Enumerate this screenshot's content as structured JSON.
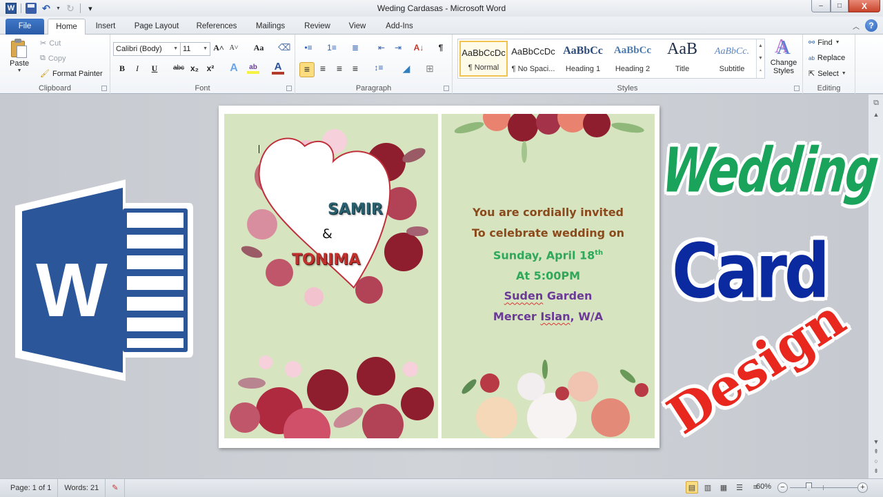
{
  "window": {
    "title": "Weding Cardasas - Microsoft Word",
    "controls": {
      "minimize": "–",
      "maximize": "□",
      "close": "X"
    }
  },
  "quick_access": {
    "app_icon_letter": "W",
    "undo_glyph": "↶",
    "redo_glyph": "↻",
    "customize_glyph": "▾"
  },
  "tabs": [
    {
      "label": "File"
    },
    {
      "label": "Home",
      "active": true
    },
    {
      "label": "Insert"
    },
    {
      "label": "Page Layout"
    },
    {
      "label": "References"
    },
    {
      "label": "Mailings"
    },
    {
      "label": "Review"
    },
    {
      "label": "View"
    },
    {
      "label": "Add-Ins"
    }
  ],
  "ribbon": {
    "clipboard": {
      "label": "Clipboard",
      "paste": "Paste",
      "cut": "Cut",
      "copy": "Copy",
      "format_painter": "Format Painter"
    },
    "font": {
      "label": "Font",
      "font_name": "Calibri (Body)",
      "font_size": "11",
      "grow": "A˄",
      "shrink": "A˅",
      "change_case": "Aa",
      "bold": "B",
      "italic": "I",
      "underline": "U",
      "strikethrough": "abc",
      "subscript": "x₂",
      "superscript": "x²",
      "text_effects": "A",
      "highlight": "ab",
      "font_color": "A"
    },
    "paragraph": {
      "label": "Paragraph",
      "bullets": "•≡",
      "numbering": "1≡",
      "multilevel": "≣",
      "decrease_indent": "⇤",
      "increase_indent": "⇥",
      "sort": "A↓",
      "show_marks": "¶",
      "align_left": "≡",
      "center": "≡",
      "align_right": "≡",
      "justify": "≡",
      "line_spacing": "↕≡",
      "shading": "◢",
      "borders": "⊞"
    },
    "styles": {
      "label": "Styles",
      "items": [
        {
          "sample": "AaBbCcDc",
          "name": "¶ Normal",
          "selected": true
        },
        {
          "sample": "AaBbCcDc",
          "name": "¶ No Spaci..."
        },
        {
          "sample": "AaBbCc",
          "name": "Heading 1"
        },
        {
          "sample": "AaBbCc",
          "name": "Heading 2"
        },
        {
          "sample": "AaB",
          "name": "Title"
        },
        {
          "sample": "AaBbCc.",
          "name": "Subtitle"
        }
      ],
      "change_styles": "Change Styles"
    },
    "editing": {
      "label": "Editing",
      "find": "Find",
      "replace": "Replace",
      "select": "Select"
    }
  },
  "document": {
    "card": {
      "names": {
        "groom": "SAMIR",
        "ampersand": "&",
        "bride": "TONIMA"
      },
      "invitation": {
        "line1": "You are cordially invited",
        "line2": "To celebrate wedding on",
        "line3_main": "Sunday, April 18",
        "line3_sup": "th",
        "line4": "At 5:00PM",
        "line5_misspelled": "Suden",
        "line5_rest": " Garden",
        "line6_pre": "Mercer ",
        "line6_misspelled": "Islan",
        "line6_rest": ", W/A"
      },
      "colors": {
        "panel_bg": "#d7e4c0",
        "invite_brown": "#8a4a1c",
        "invite_green": "#2fa85a",
        "invite_purple": "#6b3a96",
        "groom": "#2a5f6e",
        "bride": "#c0312e"
      }
    }
  },
  "overlay": {
    "word_logo_letter": "W",
    "title_words": [
      "Wedding",
      "Card",
      "Design"
    ],
    "colors": {
      "wedding": "#1aa35a",
      "card": "#0b2aa0",
      "design": "#e8281e",
      "word_blue": "#2b579a"
    }
  },
  "statusbar": {
    "page": "Page: 1 of 1",
    "words": "Words: 21",
    "zoom_percent": "60%",
    "zoom_level": 60,
    "zoom_minus": "−",
    "zoom_plus": "+"
  }
}
